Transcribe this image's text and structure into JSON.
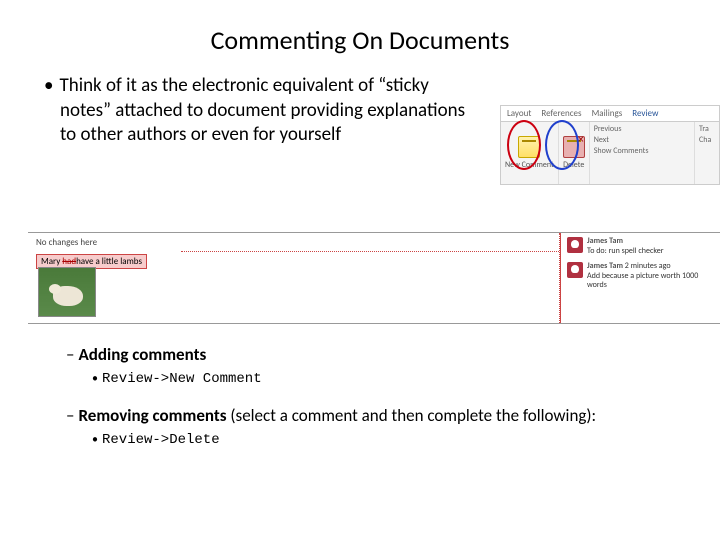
{
  "title": "Commenting On Documents",
  "main_bullet": "Think of it as the electronic equivalent of “sticky notes” attached to document providing explanations to other authors or even for yourself",
  "ribbon": {
    "tabs": {
      "t1": "Layout",
      "t2": "References",
      "t3": "Mailings",
      "t4": "Review"
    },
    "new_comment": "New Comment",
    "delete": "Delete",
    "right1": "Previous",
    "right2": "Next",
    "right3": "Show Comments",
    "far1": "Tra",
    "far2": "Cha"
  },
  "doc_example": {
    "line1": "No changes here",
    "line2_pre": "Mary ",
    "line2_strike": "had",
    "line2_post": "have a little lambs",
    "comment1": {
      "author": "James Tam",
      "text": "To do: run spell checker"
    },
    "comment2": {
      "author": "James Tam",
      "time": "2 minutes ago",
      "text": "Add because a picture worth 1000 words"
    }
  },
  "sections": {
    "adding": {
      "heading": "Adding comments",
      "item": "Review->New Comment"
    },
    "removing": {
      "heading_bold": "Removing comments",
      "heading_rest": " (select a comment and then complete the following):",
      "item": "Review->Delete"
    }
  }
}
